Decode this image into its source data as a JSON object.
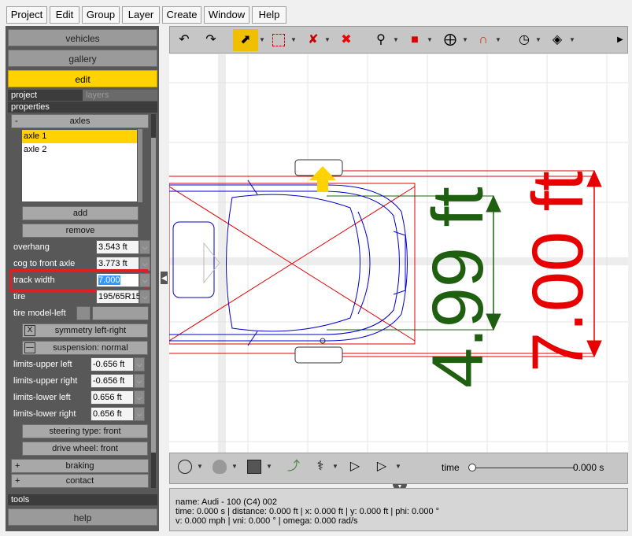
{
  "menu": [
    "Project",
    "Edit",
    "Group",
    "Layer",
    "Create",
    "Window",
    "Help"
  ],
  "left": {
    "nav": [
      "vehicles",
      "gallery",
      "edit"
    ],
    "tabs": {
      "project": "project",
      "layers": "layers"
    },
    "properties_label": "properties",
    "axles_section": {
      "toggle": "-",
      "label": "axles"
    },
    "axle_list": [
      "axle 1",
      "axle 2"
    ],
    "add_label": "add",
    "remove_label": "remove",
    "fields": {
      "overhang": {
        "label": "overhang",
        "value": "3.543 ft"
      },
      "cog": {
        "label": "cog to front axle",
        "value": "3.773 ft"
      },
      "track": {
        "label": "track width",
        "value": "7.000"
      },
      "tire": {
        "label": "tire",
        "value": "195/65R15"
      },
      "tire_model": {
        "label": "tire model-left",
        "value": ""
      }
    },
    "symmetry": {
      "check": "X",
      "label": "symmetry left-right"
    },
    "suspension": {
      "check": "—",
      "label": "suspension: normal"
    },
    "limits": {
      "upper_left": {
        "label": "limits-upper left",
        "value": "-0.656 ft"
      },
      "upper_right": {
        "label": "limits-upper right",
        "value": "-0.656 ft"
      },
      "lower_left": {
        "label": "limits-lower left",
        "value": "0.656 ft"
      },
      "lower_right": {
        "label": "limits-lower right",
        "value": "0.656 ft"
      }
    },
    "steering": "steering type: front",
    "drive": "drive wheel: front",
    "braking": {
      "toggle": "+",
      "label": "braking"
    },
    "contact": {
      "toggle": "+",
      "label": "contact"
    },
    "tools_label": "tools",
    "help_label": "help"
  },
  "canvas": {
    "dim_green": "4.99 ft",
    "dim_red": "7.00 ft",
    "colors": {
      "green": "#1f5f10",
      "red": "#e60000",
      "blue": "#0000cc",
      "yellow": "#ffd200"
    }
  },
  "timeline": {
    "label": "time",
    "value": "0.000 s"
  },
  "status": {
    "line1": "name: Audi - 100 (C4) 002",
    "line2": "time: 0.000 s | distance: 0.000 ft | x: 0.000 ft | y: 0.000 ft | phi: 0.000 °",
    "line3": "v: 0.000 mph | vni: 0.000 ° | omega: 0.000 rad/s"
  }
}
